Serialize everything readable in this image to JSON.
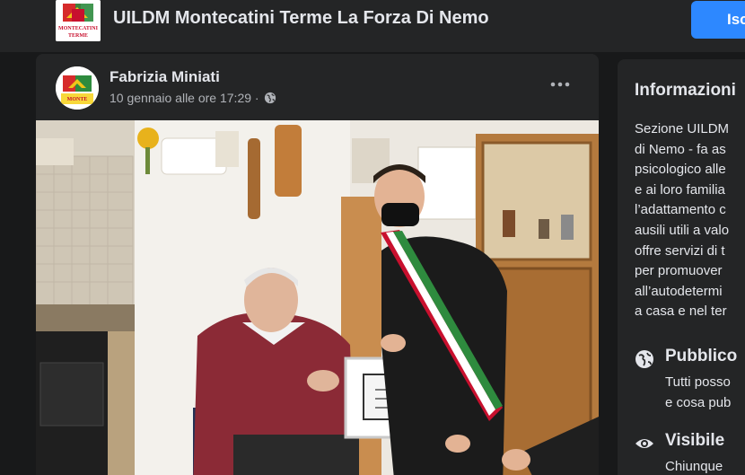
{
  "header": {
    "logo_text": "MONTECATINI TERME",
    "title": "UILDM Montecatini Terme La Forza Di Nemo",
    "join_label": "Iscriviti"
  },
  "post": {
    "author": "Fabrizia Miniati",
    "timestamp": "10 gennaio alle ore 17:29 ·",
    "audience_icon": "globe-icon",
    "more_icon": "more-options-icon"
  },
  "info": {
    "title": "Informazioni",
    "description_lines": [
      "Sezione UILDM",
      "di Nemo - fa as",
      "psicologico alle",
      "e ai loro familia",
      "l’adattamento c",
      "ausili utili a valo",
      "offre servizi di t",
      "per promuover",
      "all’autodetermi",
      "a casa e nel ter"
    ],
    "public": {
      "title": "Pubblico",
      "desc_lines": [
        "Tutti posso",
        "e cosa pub"
      ],
      "icon": "globe-icon"
    },
    "visible": {
      "title": "Visibile",
      "desc_lines": [
        "Chiunque"
      ],
      "icon": "eye-icon"
    }
  },
  "colors": {
    "background": "#18191a",
    "card": "#242526",
    "accent": "#2d88ff",
    "text_primary": "#e4e6eb",
    "text_secondary": "#b0b3b8"
  }
}
